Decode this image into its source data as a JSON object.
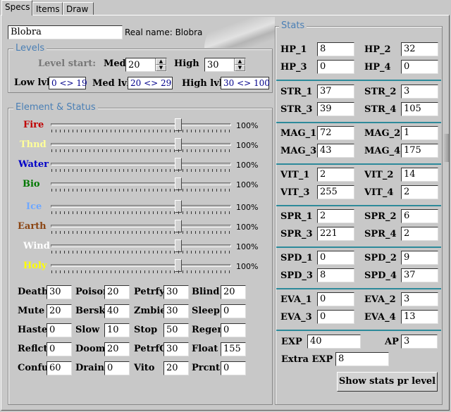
{
  "tabs": [
    "Specs",
    "Items",
    "Draw"
  ],
  "name_value": "Blobra",
  "real_name": "Real name: Blobra",
  "levels": {
    "title": "Levels",
    "level_start": "Level start:",
    "med_label": "Med.",
    "med_value": "20",
    "high_label": "High",
    "high_value": "30",
    "low_lbl": "Low lvl",
    "low_range": "0 <> 19",
    "med_lbl": "Med lvl",
    "med_range": "20 <> 29",
    "high_lbl": "High lvl",
    "high_range": "30 <> 100"
  },
  "element_status": {
    "title": "Element & Status",
    "elements": [
      {
        "name": "Fire",
        "color": "#c00000",
        "pct": "100%",
        "level": 1.0
      },
      {
        "name": "Thnd",
        "color": "#ffff99",
        "pct": "100%",
        "level": 1.0
      },
      {
        "name": "Water",
        "color": "#0000c8",
        "pct": "100%",
        "level": 1.0
      },
      {
        "name": "Bio",
        "color": "#007800",
        "pct": "100%",
        "level": 1.0
      },
      {
        "name": "Ice",
        "color": "#6fa8ff",
        "pct": "100%",
        "level": 1.0
      },
      {
        "name": "Earth",
        "color": "#8b4513",
        "pct": "100%",
        "level": 1.0
      },
      {
        "name": "Wind",
        "color": "#ffffff",
        "pct": "100%",
        "level": 1.0
      },
      {
        "name": "Holy",
        "color": "#ffff00",
        "pct": "100%",
        "level": 1.0
      }
    ],
    "statuses": [
      [
        {
          "label": "Death",
          "value": "30"
        },
        {
          "label": "Poison",
          "value": "20"
        },
        {
          "label": "Petrfy",
          "value": "30"
        },
        {
          "label": "Blind",
          "value": "20"
        }
      ],
      [
        {
          "label": "Mute",
          "value": "20"
        },
        {
          "label": "Bersk",
          "value": "40"
        },
        {
          "label": "Zmbie",
          "value": "30"
        },
        {
          "label": "Sleep",
          "value": "0"
        }
      ],
      [
        {
          "label": "Haste",
          "value": "0"
        },
        {
          "label": "Slow",
          "value": "10"
        },
        {
          "label": "Stop",
          "value": "50"
        },
        {
          "label": "Regen",
          "value": "0"
        }
      ],
      [
        {
          "label": "Reflct",
          "value": "0"
        },
        {
          "label": "Doom",
          "value": "20"
        },
        {
          "label": "PetrfC",
          "value": "30"
        },
        {
          "label": "Float",
          "value": "155"
        }
      ],
      [
        {
          "label": "Confu",
          "value": "60"
        },
        {
          "label": "Drain",
          "value": "0"
        },
        {
          "label": "Vito",
          "value": "20"
        },
        {
          "label": "Prcnt",
          "value": "0"
        }
      ]
    ]
  },
  "stats": {
    "title": "Stats",
    "groups": [
      [
        {
          "label": "HP_1",
          "value": "8"
        },
        {
          "label": "HP_2",
          "value": "32"
        },
        {
          "label": "HP_3",
          "value": "0"
        },
        {
          "label": "HP_4",
          "value": "0"
        }
      ],
      [
        {
          "label": "STR_1",
          "value": "37"
        },
        {
          "label": "STR_2",
          "value": "3"
        },
        {
          "label": "STR_3",
          "value": "39"
        },
        {
          "label": "STR_4",
          "value": "105"
        }
      ],
      [
        {
          "label": "MAG_1",
          "value": "72"
        },
        {
          "label": "MAG_2",
          "value": "1"
        },
        {
          "label": "MAG_3",
          "value": "43"
        },
        {
          "label": "MAG_4",
          "value": "175"
        }
      ],
      [
        {
          "label": "VIT_1",
          "value": "2"
        },
        {
          "label": "VIT_2",
          "value": "14"
        },
        {
          "label": "VIT_3",
          "value": "255"
        },
        {
          "label": "VIT_4",
          "value": "2"
        }
      ],
      [
        {
          "label": "SPR_1",
          "value": "2"
        },
        {
          "label": "SPR_2",
          "value": "6"
        },
        {
          "label": "SPR_3",
          "value": "221"
        },
        {
          "label": "SPR_4",
          "value": "2"
        }
      ],
      [
        {
          "label": "SPD_1",
          "value": "0"
        },
        {
          "label": "SPD_2",
          "value": "9"
        },
        {
          "label": "SPD_3",
          "value": "8"
        },
        {
          "label": "SPD_4",
          "value": "37"
        }
      ],
      [
        {
          "label": "EVA_1",
          "value": "0"
        },
        {
          "label": "EVA_2",
          "value": "3"
        },
        {
          "label": "EVA_3",
          "value": "0"
        },
        {
          "label": "EVA_4",
          "value": "13"
        }
      ]
    ],
    "exp_label": "EXP",
    "exp_value": "40",
    "ap_label": "AP",
    "ap_value": "3",
    "extra_exp_label": "Extra EXP",
    "extra_exp_value": "8",
    "show_button": "Show stats pr level"
  }
}
